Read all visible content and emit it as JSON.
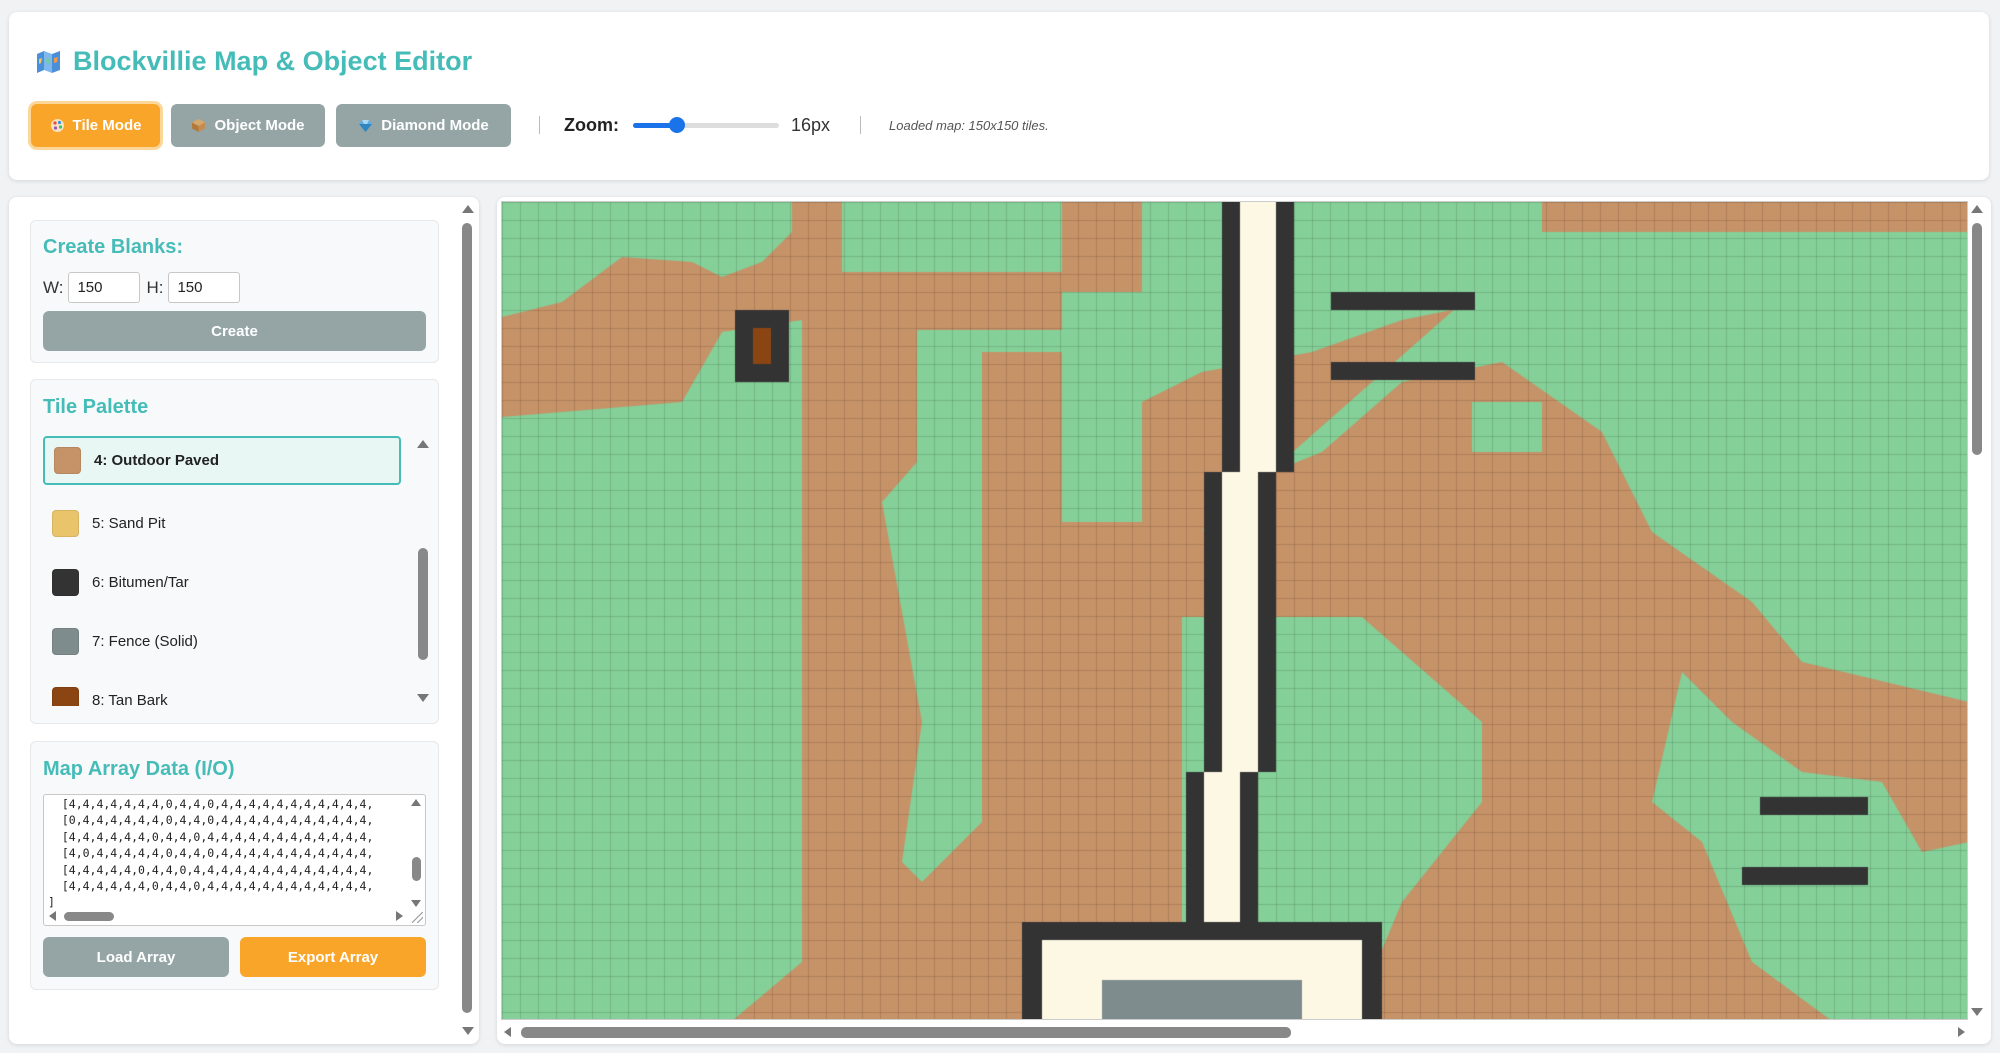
{
  "header": {
    "title": "Blockvillie Map & Object Editor",
    "title_icon": "map-icon",
    "modes": [
      {
        "label": "Tile Mode",
        "icon": "palette-icon",
        "active": true
      },
      {
        "label": "Object Mode",
        "icon": "box-icon",
        "active": false
      },
      {
        "label": "Diamond Mode",
        "icon": "diamond-icon",
        "active": false
      }
    ],
    "zoom_label": "Zoom:",
    "zoom_value": "16px",
    "zoom_level": 0.3,
    "status": "Loaded map: 150x150 tiles."
  },
  "colors": {
    "accent": "#46bcb8",
    "orange": "#f8a52a",
    "gray_button": "#95a5a6",
    "slider": "#1a73e8",
    "grass": "#84d098",
    "paved": "#c69268",
    "tar": "#333333",
    "path": "#fdf8e4",
    "fence": "#7f8c8d",
    "tan_bark": "#8b4513"
  },
  "sidebar": {
    "create": {
      "title": "Create Blanks:",
      "width_label": "W:",
      "width_value": "150",
      "height_label": "H:",
      "height_value": "150",
      "button": "Create"
    },
    "palette": {
      "title": "Tile Palette",
      "items": [
        {
          "label": "4: Outdoor Paved",
          "color": "#c69268",
          "selected": true
        },
        {
          "label": "5: Sand Pit",
          "color": "#e9c46a",
          "selected": false
        },
        {
          "label": "6: Bitumen/Tar",
          "color": "#333333",
          "selected": false
        },
        {
          "label": "7: Fence (Solid)",
          "color": "#7f8c8d",
          "selected": false
        },
        {
          "label": "8: Tan Bark",
          "color": "#8b4513",
          "selected": false
        }
      ]
    },
    "io": {
      "title": "Map Array Data (I/O)",
      "text": "  [4,4,4,4,4,4,4,0,4,4,0,4,4,4,4,4,4,4,4,4,4,4,\n  [0,4,4,4,4,4,4,0,4,4,0,4,4,4,4,4,4,4,4,4,4,4,\n  [4,4,4,4,4,4,0,4,4,0,4,4,4,4,4,4,4,4,4,4,4,4,\n  [4,0,4,4,4,4,4,0,4,4,0,4,4,4,4,4,4,4,4,4,4,4,\n  [4,4,4,4,4,0,4,4,0,4,4,4,4,4,4,4,4,4,4,4,4,4,\n  [4,4,4,4,4,4,0,4,4,0,4,4,4,4,4,4,4,4,4,4,4,4,\n]",
      "load_button": "Load Array",
      "export_button": "Export Array"
    }
  }
}
